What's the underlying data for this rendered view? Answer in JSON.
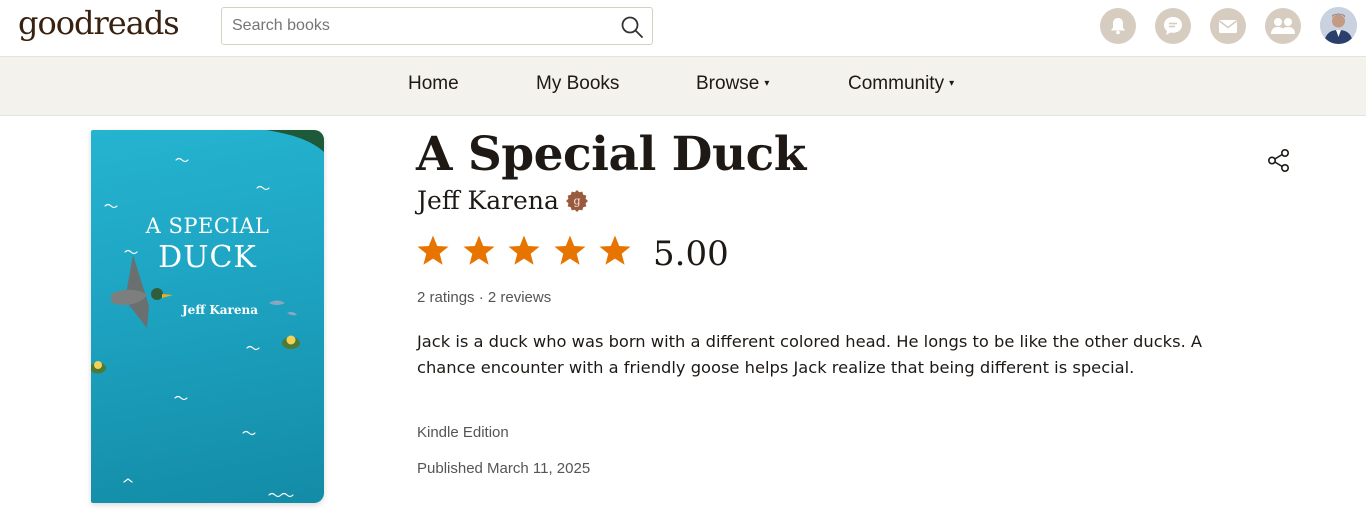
{
  "header": {
    "logo_text": "goodreads",
    "search": {
      "placeholder": "Search books",
      "value": ""
    },
    "icons": [
      "search-icon",
      "bell-icon",
      "chat-icon",
      "mail-icon",
      "friends-icon",
      "avatar"
    ]
  },
  "nav": {
    "items": [
      {
        "label": "Home",
        "has_dropdown": false
      },
      {
        "label": "My Books",
        "has_dropdown": false
      },
      {
        "label": "Browse",
        "has_dropdown": true,
        "caret": "▾"
      },
      {
        "label": "Community",
        "has_dropdown": true,
        "caret": "▾"
      }
    ]
  },
  "book": {
    "cover": {
      "title_line1": "A SPECIAL",
      "title_line2": "DUCK",
      "author": "Jeff Karena"
    },
    "title": "A Special Duck",
    "author": "Jeff Karena",
    "author_badge": "goodreads-author-badge-icon",
    "rating": {
      "stars": 5,
      "max_stars": 5,
      "value": "5.00"
    },
    "counts": "2 ratings · 2 reviews",
    "description": "Jack is a duck who was born with a different colored head. He longs to be like the other ducks. A chance encounter with a friendly goose helps Jack realize that being different is special.",
    "format": "Kindle Edition",
    "published": "Published March 11, 2025"
  },
  "colors": {
    "brand": "#382110",
    "star": "#e87400",
    "nav_bg": "#f4f2ec",
    "icon_bg": "#d6cdc0",
    "cover_bg": "#1da3c1"
  }
}
